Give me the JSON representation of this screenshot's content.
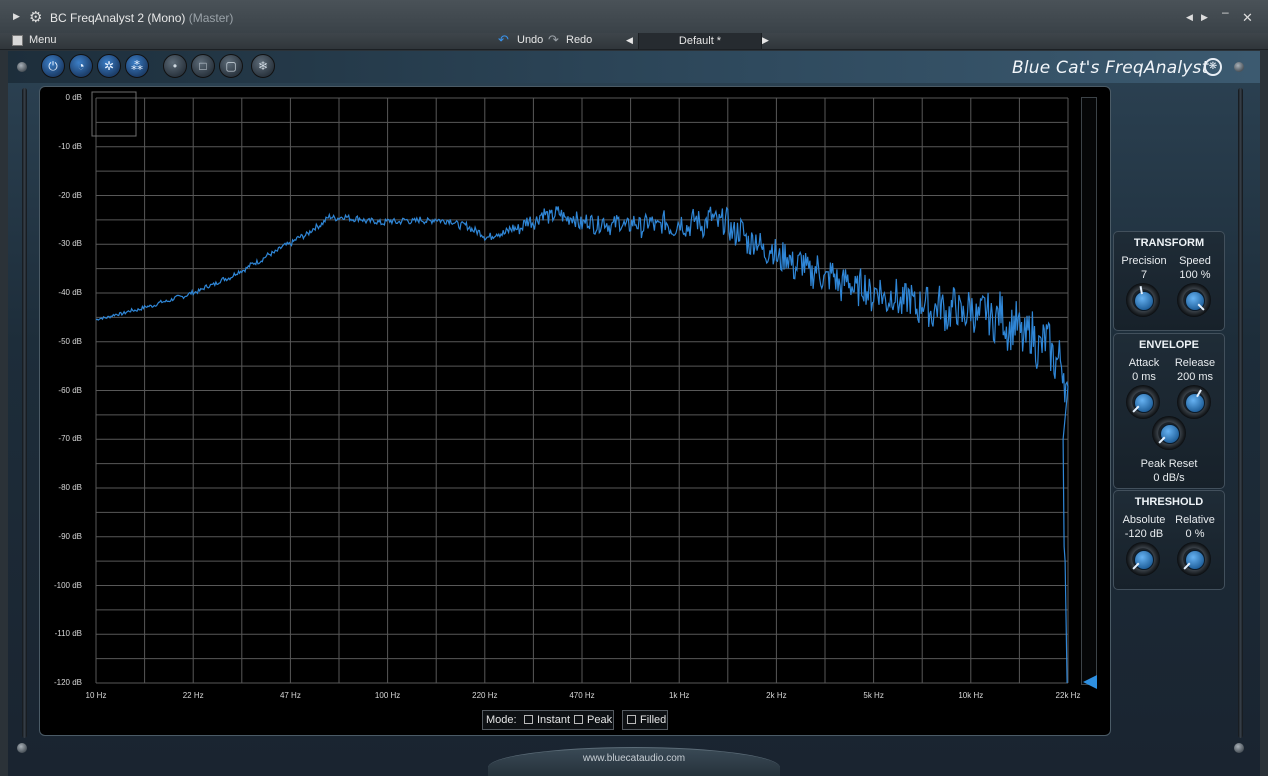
{
  "window": {
    "title": "BC FreqAnalyst 2 (Mono)",
    "subtitle": "(Master)"
  },
  "menubar": {
    "menu": "Menu",
    "undo": "Undo",
    "redo": "Redo",
    "preset": "Default *"
  },
  "brand": "Blue Cat's FreqAnalyst",
  "graph": {
    "y_labels": [
      "0 dB",
      "-10 dB",
      "-20 dB",
      "-30 dB",
      "-40 dB",
      "-50 dB",
      "-60 dB",
      "-70 dB",
      "-80 dB",
      "-90 dB",
      "-100 dB",
      "-110 dB",
      "-120 dB"
    ],
    "x_labels": [
      "10 Hz",
      "22 Hz",
      "47 Hz",
      "100 Hz",
      "220 Hz",
      "470 Hz",
      "1k Hz",
      "2k Hz",
      "5k Hz",
      "10k Hz",
      "22k Hz"
    ]
  },
  "modebar": {
    "mode_label": "Mode:",
    "instant": "Instant",
    "peak": "Peak",
    "filled": "Filled"
  },
  "footer": "www.bluecataudio.com",
  "panels": {
    "transform": {
      "title": "TRANSFORM",
      "precision_label": "Precision",
      "precision_value": "7",
      "speed_label": "Speed",
      "speed_value": "100 %"
    },
    "envelope": {
      "title": "ENVELOPE",
      "attack_label": "Attack",
      "attack_value": "0 ms",
      "release_label": "Release",
      "release_value": "200 ms",
      "peak_reset_label": "Peak Reset",
      "peak_reset_value": "0 dB/s"
    },
    "threshold": {
      "title": "THRESHOLD",
      "absolute_label": "Absolute",
      "absolute_value": "-120 dB",
      "relative_label": "Relative",
      "relative_value": "0 %"
    }
  },
  "colors": {
    "spectrum": "#2f86d6",
    "accent": "#2e8fe0"
  }
}
